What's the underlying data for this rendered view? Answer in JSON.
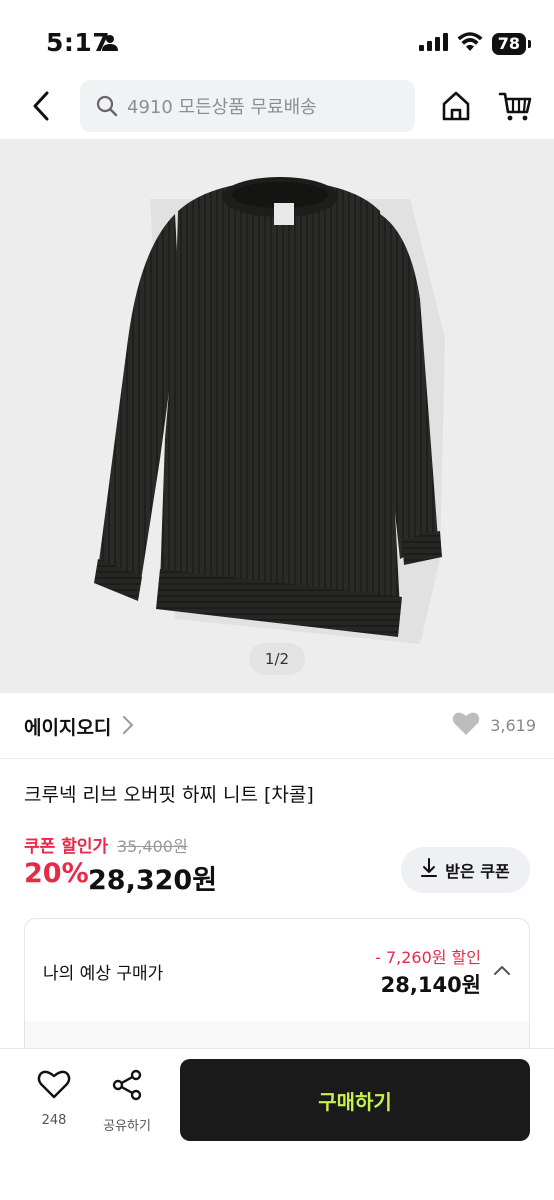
{
  "status_bar": {
    "time": "5:17",
    "battery": "78"
  },
  "header": {
    "search_placeholder": "4910 모든상품 무료배송"
  },
  "product": {
    "image_counter": "1/2",
    "brand": "에이지오디",
    "like_count": "3,619",
    "title": "크루넥 리브 오버핏 하찌 니트 [차콜]"
  },
  "price": {
    "coupon_label": "쿠폰 할인가",
    "original_price": "35,400원",
    "discount_rate": "20%",
    "sale_price": "28,320원",
    "coupon_button": "받은 쿠폰"
  },
  "expected": {
    "label": "나의 예상 구매가",
    "discount": "- 7,260원 할인",
    "price": "28,140원"
  },
  "bottom_bar": {
    "like_count": "248",
    "share_label": "공유하기",
    "buy_label": "구매하기"
  },
  "colors": {
    "sale_red": "#e8294a",
    "buy_button_bg": "#1a1a1a",
    "buy_button_text": "#c6f24e"
  }
}
